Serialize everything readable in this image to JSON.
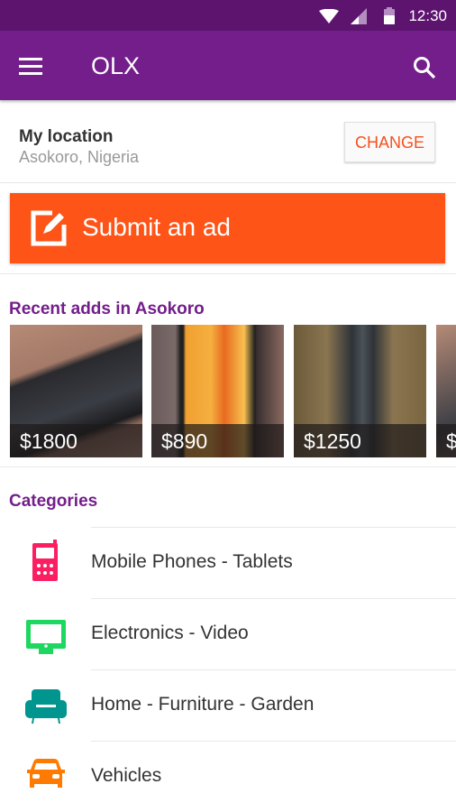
{
  "status_bar": {
    "time": "12:30",
    "icons": [
      "wifi-icon",
      "signal-icon",
      "battery-icon"
    ]
  },
  "app_bar": {
    "title": "OLX",
    "menu_icon": "menu-icon",
    "search_icon": "search-icon"
  },
  "location": {
    "label": "My location",
    "value": "Asokoro, Nigeria",
    "change_label": "CHANGE"
  },
  "submit": {
    "label": "Submit an ad",
    "icon": "edit-icon"
  },
  "recent": {
    "title": "Recent adds in Asokoro",
    "items": [
      {
        "price": "$1800"
      },
      {
        "price": "$890"
      },
      {
        "price": "$1250"
      },
      {
        "price": "$"
      }
    ]
  },
  "categories": {
    "title": "Categories",
    "items": [
      {
        "label": "Mobile Phones - Tablets",
        "icon": "mobile-phone-icon",
        "color": "#fb1f62"
      },
      {
        "label": "Electronics - Video",
        "icon": "monitor-icon",
        "color": "#1ed760"
      },
      {
        "label": "Home - Furniture - Garden",
        "icon": "sofa-icon",
        "color": "#00968f"
      },
      {
        "label": "Vehicles",
        "icon": "car-icon",
        "color": "#ff7a00"
      }
    ]
  },
  "colors": {
    "status_bar": "#5c146f",
    "app_bar": "#741e8b",
    "accent": "#fe5417",
    "section_title": "#741e8b"
  }
}
